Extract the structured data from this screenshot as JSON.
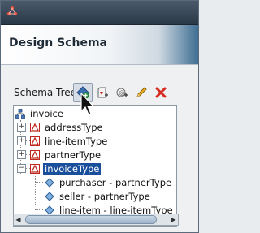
{
  "dialog": {
    "title": "Design Schema"
  },
  "toolbar": {
    "label": "Schema Tree",
    "buttons": [
      {
        "name": "add-complex-type",
        "icon": "add-type-icon",
        "active": true
      },
      {
        "name": "add-element",
        "icon": "add-element-icon"
      },
      {
        "name": "add-attribute",
        "icon": "add-attribute-icon"
      },
      {
        "name": "edit",
        "icon": "pencil-icon"
      },
      {
        "name": "delete",
        "icon": "delete-x-icon"
      }
    ]
  },
  "tree": {
    "root": "invoice",
    "types": [
      "addressType",
      "line-itemType",
      "partnerType",
      "invoiceType"
    ],
    "selected": "invoiceType",
    "children": [
      "purchaser - partnerType",
      "seller - partnerType",
      "line-item - line-itemType"
    ]
  },
  "colors": {
    "selection": "#1a4f9c",
    "type_icon": "#c0281f",
    "delete": "#d62a1e"
  }
}
